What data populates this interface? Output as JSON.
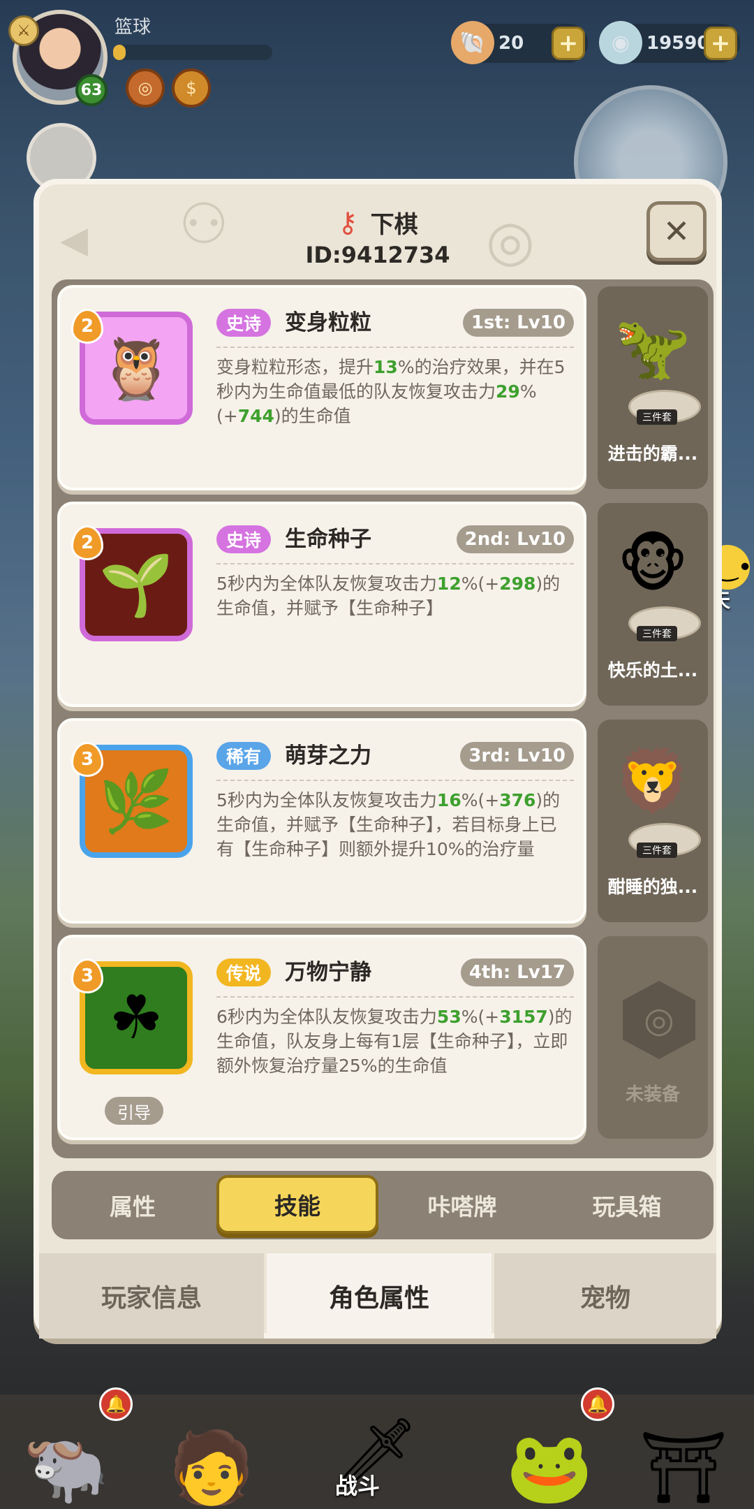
{
  "hud": {
    "player_name": "篮球",
    "level": "63",
    "currency_shells": "20",
    "currency_gems": "19590",
    "exp_fraction": 0.08
  },
  "chat_label": "聊天",
  "modal": {
    "title": "下棋",
    "player_id": "ID:9412734",
    "skills": [
      {
        "level": "2",
        "rarity": "史诗",
        "rarity_color": "#d573e0",
        "name": "变身粒粒",
        "slot": "1st: Lv10",
        "desc_parts": [
          "变身粒粒形态，提升",
          "13",
          "%的治疗效果，并在5秒内为生命值最低的队友恢复攻击力",
          "29",
          "%(+",
          "744",
          ")的生命值"
        ],
        "icon": "owl-spirit-icon",
        "equip": {
          "name": "进击的霸...",
          "set": "三件套",
          "figure": "red-dragon-figure"
        }
      },
      {
        "level": "2",
        "rarity": "史诗",
        "rarity_color": "#d573e0",
        "name": "生命种子",
        "slot": "2nd: Lv10",
        "desc_parts": [
          "5秒内为全体队友恢复攻击力",
          "12",
          "%(+",
          "298",
          ")的生命值，并赋予【生命种子】"
        ],
        "icon": "life-seed-icon",
        "equip": {
          "name": "快乐的土...",
          "set": "三件套",
          "figure": "monkey-sprout-figure"
        }
      },
      {
        "level": "3",
        "rarity": "稀有",
        "rarity_color": "#5aa4e8",
        "name": "萌芽之力",
        "slot": "3rd: Lv10",
        "desc_parts": [
          "5秒内为全体队友恢复攻击力",
          "16",
          "%(+",
          "376",
          ")的生命值，并赋予【生命种子】，若目标身上已有【生命种子】则额外提升10%的治疗量"
        ],
        "icon": "sprout-power-icon",
        "equip": {
          "name": "酣睡的独...",
          "set": "三件套",
          "figure": "sleepy-monkey-figure"
        }
      },
      {
        "level": "3",
        "rarity": "传说",
        "rarity_color": "#f2b621",
        "name": "万物宁静",
        "slot": "4th: Lv17",
        "desc_parts": [
          "6秒内为全体队友恢复攻击力",
          "53",
          "%(+",
          "3157",
          ")的生命值，队友身上每有1层【生命种子】，立即额外恢复治疗量25%的生命值"
        ],
        "icon": "clover-calm-icon",
        "tag": "引导",
        "equip": {
          "empty_label": "未装备"
        }
      }
    ],
    "sub_tabs": [
      "属性",
      "技能",
      "咔嗒牌",
      "玩具箱"
    ],
    "bottom_tabs": [
      "玩家信息",
      "角色属性",
      "宠物"
    ]
  },
  "nav": {
    "battle_label": "战斗"
  }
}
